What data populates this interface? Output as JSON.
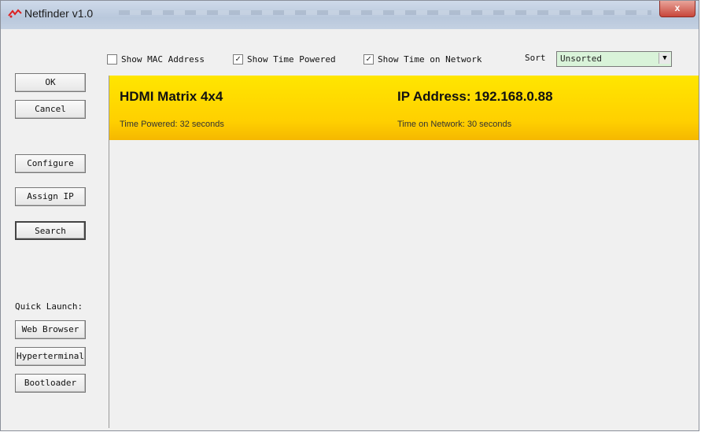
{
  "window": {
    "title": "Netfinder v1.0",
    "close": "x"
  },
  "options": {
    "show_mac": {
      "label": "Show MAC Address",
      "checked": false
    },
    "show_time_powered": {
      "label": "Show Time Powered",
      "checked": true
    },
    "show_time_network": {
      "label": "Show Time on Network",
      "checked": true
    }
  },
  "sort": {
    "label": "Sort",
    "value": "Unsorted"
  },
  "buttons": {
    "ok": "OK",
    "cancel": "Cancel",
    "configure": "Configure",
    "assign_ip": "Assign IP",
    "search": "Search"
  },
  "quick_launch": {
    "label": "Quick Launch:",
    "web_browser": "Web Browser",
    "hyperterminal": "Hyperterminal",
    "bootloader": "Bootloader"
  },
  "devices": [
    {
      "name": "HDMI Matrix 4x4",
      "ip": "IP Address: 192.168.0.88",
      "time_powered": "Time Powered:  32 seconds",
      "time_network": "Time on Network:  30 seconds"
    }
  ],
  "colors": {
    "device_highlight": "#ffd800",
    "sort_bg": "#d9f3d9"
  },
  "icons": {
    "app": "netfinder-app-icon",
    "checkmark": "check-icon",
    "dropdown": "chevron-down-icon"
  }
}
